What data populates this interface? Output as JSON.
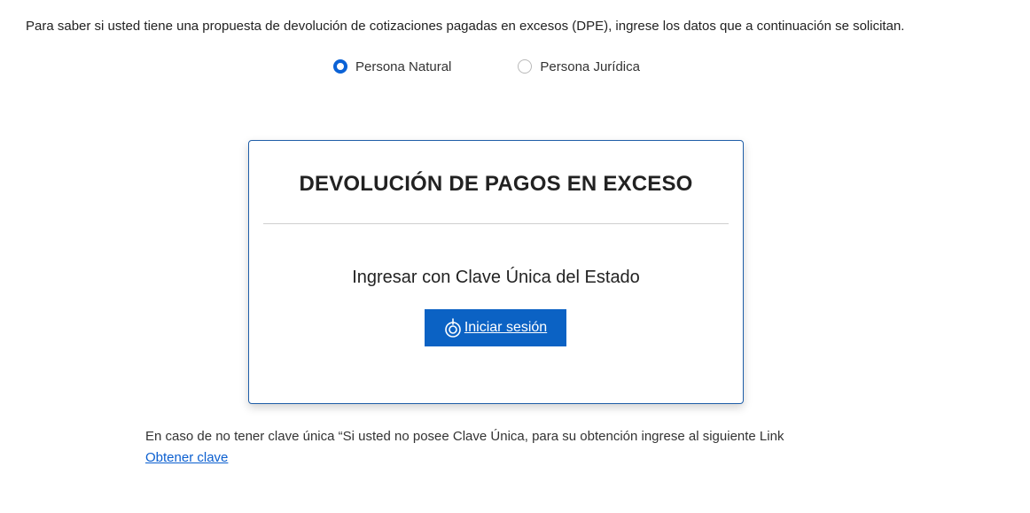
{
  "intro": {
    "text": "Para saber si usted tiene una propuesta de devolución de cotizaciones pagadas en excesos (DPE), ingrese los datos que a continuación se solicitan."
  },
  "person_type": {
    "options": [
      {
        "label": "Persona Natural",
        "selected": true
      },
      {
        "label": "Persona Jurídica",
        "selected": false
      }
    ]
  },
  "card": {
    "title": "DEVOLUCIÓN DE PAGOS EN EXCESO",
    "subtitle": "Ingresar con Clave Única del Estado",
    "login_button": {
      "label": "Iniciar sesión",
      "icon": "clave-unica-icon"
    }
  },
  "footer": {
    "text": "En caso de no tener clave única “Si usted no posee Clave Única, para su obtención ingrese al siguiente Link",
    "link_label": "Obtener clave"
  },
  "colors": {
    "primary": "#0b62c4",
    "radio_checked": "#0b62d6",
    "card_border": "#1f5ea8",
    "link": "#0b5fd0"
  }
}
